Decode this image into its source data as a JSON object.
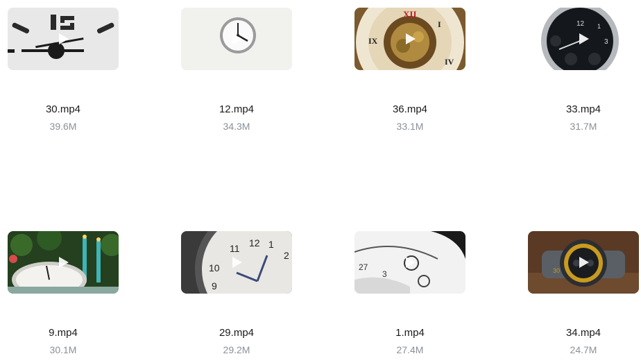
{
  "videos": [
    {
      "name": "30.mp4",
      "size": "39.6M",
      "thumb": "wall-clock-12-icon"
    },
    {
      "name": "12.mp4",
      "size": "34.3M",
      "thumb": "silver-wall-clock-icon"
    },
    {
      "name": "36.mp4",
      "size": "33.1M",
      "thumb": "pocket-watch-roman-icon"
    },
    {
      "name": "33.mp4",
      "size": "31.7M",
      "thumb": "black-dial-clock-icon"
    },
    {
      "name": "9.mp4",
      "size": "30.1M",
      "thumb": "christmas-clock-icon"
    },
    {
      "name": "29.mp4",
      "size": "29.2M",
      "thumb": "alarm-clock-closeup-icon"
    },
    {
      "name": "1.mp4",
      "size": "27.4M",
      "thumb": "blurred-watch-dial-icon"
    },
    {
      "name": "34.mp4",
      "size": "24.7M",
      "thumb": "wristwatch-yellow-icon"
    }
  ],
  "icons": {
    "play": "play-icon"
  },
  "colors": {
    "size_text": "#8a9099",
    "name_text": "#1a1a1a"
  }
}
